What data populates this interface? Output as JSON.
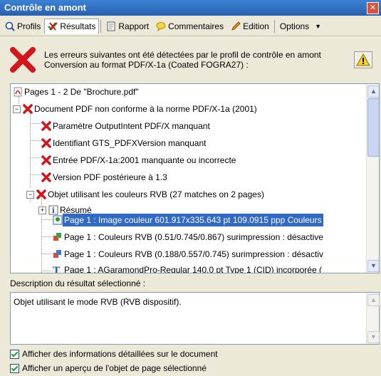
{
  "window": {
    "title": "Contrôle en amont"
  },
  "tabs": [
    {
      "label": "Profils",
      "icon": "magnifier-icon"
    },
    {
      "label": "Résultats",
      "icon": "results-icon"
    },
    {
      "label": "Rapport",
      "icon": "report-icon"
    },
    {
      "label": "Commentaires",
      "icon": "comments-icon"
    },
    {
      "label": "Edition",
      "icon": "pencil-icon"
    },
    {
      "label": "Options",
      "icon": "dropdown-icon"
    }
  ],
  "message": "Les erreurs suivantes ont été détectées par le profil de contrôle en amont Conversion au format PDF/X-1a (Coated FOGRA27) :",
  "tree": {
    "root": "Pages 1 - 2 De \"Brochure.pdf\"",
    "items": [
      "Document PDF non conforme à la norme PDF/X-1a (2001)",
      "Paramètre OutputIntent PDF/X manquant",
      "Identifiant GTS_PDFXVersion manquant",
      "Entrée PDF/X-1a:2001 manquante ou incorrecte",
      "Version PDF postérieure à 1.3",
      "Objet utilisant les couleurs RVB (27 matches on 2 pages)",
      "Résumé",
      "Page 1 : Image couleur 601.917x335.643 pt 109.0915 ppp Couleurs",
      "Page 1 : Couleurs RVB (0.51/0.745/0.867)  surimpression : désactive",
      "Page 1 : Couleurs RVB (0.188/0.557/0.745)  surimpression : désactiv",
      "Page 1 : AGaramondPro-Regular 140.0 pt Type 1 (CID)  incorporée ("
    ]
  },
  "description_label": "Description du résultat sélectionné :",
  "description_text": "Objet utilisant le mode RVB (RVB dispositif).",
  "checkboxes": [
    {
      "label": "Afficher des informations détaillées sur le document",
      "checked": true
    },
    {
      "label": "Afficher un aperçu de l'objet de page sélectionné",
      "checked": true
    }
  ],
  "colors": {
    "title": "#2a5fb0",
    "selection": "#316ac5",
    "error": "#d4151b"
  }
}
